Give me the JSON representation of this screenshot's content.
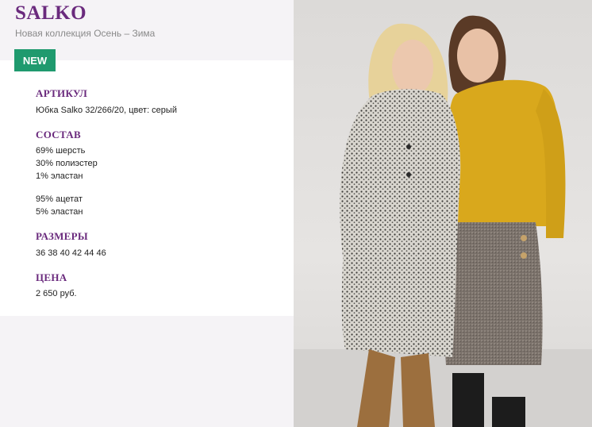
{
  "header": {
    "brand": "SALKO",
    "subtitle": "Новая коллекция Осень – Зима",
    "badge": "NEW"
  },
  "sections": {
    "article": {
      "title": "АРТИКУЛ",
      "lines": [
        "Юбка Salko 32/266/20, цвет: серый"
      ]
    },
    "composition": {
      "title": "СОСТАВ",
      "group1": [
        "69% шерсть",
        "30% полиэстер",
        "1% эластан"
      ],
      "group2": [
        "95% ацетат",
        "5% эластан"
      ]
    },
    "sizes": {
      "title": "РАЗМЕРЫ",
      "value": "36 38 40 42 44 46"
    },
    "price": {
      "title": "ЦЕНА",
      "value": "2 650 руб."
    }
  },
  "colors": {
    "brand": "#6a2a7d",
    "badge": "#1f9a6e",
    "panel": "#f5f3f6"
  },
  "photo": {
    "description_icon": "product-photo"
  }
}
